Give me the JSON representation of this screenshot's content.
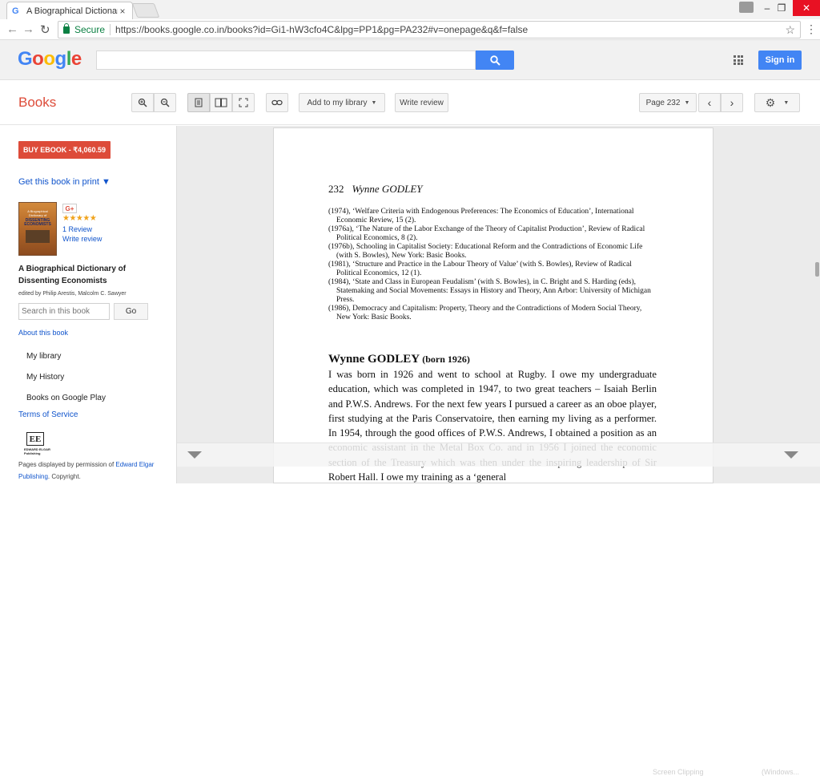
{
  "browser": {
    "tab_title": "A Biographical Dictionary",
    "tab_close": "×",
    "secure_label": "Secure",
    "url": "https://books.google.co.in/books?id=Gi1-hW3cfo4C&lpg=PP1&pg=PA232#v=onepage&q&f=false",
    "window_controls": {
      "minimize": "–",
      "restore": "❐",
      "close": "✕"
    }
  },
  "google_header": {
    "logo": [
      "G",
      "o",
      "o",
      "g",
      "l",
      "e"
    ],
    "search_value": "",
    "signin_label": "Sign in"
  },
  "books_toolbar": {
    "title": "Books",
    "add_library_label": "Add to my library",
    "write_review_label": "Write review",
    "page_label": "Page 232"
  },
  "sidebar": {
    "buy_label": "BUY EBOOK - ₹4,060.59",
    "print_label": "Get this book in print ▼",
    "cover_top": "A Biographical Dictionary of",
    "cover_main": "DISSENTING ECONOMISTS",
    "gplus": "G+",
    "stars": "★★★★★",
    "review_count": "1 Review",
    "write_review": "Write review",
    "book_title": "A Biographical Dictionary of Dissenting Economists",
    "editors": "edited by Philip Arestis, Malcolm C. Sawyer",
    "search_placeholder": "Search in this book",
    "go_label": "Go",
    "about_label": "About this book",
    "items": [
      "My library",
      "My History",
      "Books on Google Play"
    ],
    "tos_label": "Terms of Service",
    "publisher_logo": "EE",
    "publisher_name": "EDWARD ELGAR Publishing",
    "permission_prefix": "Pages displayed by permission of ",
    "permission_link": "Edward Elgar Publishing",
    "permission_suffix": ". Copyright."
  },
  "page": {
    "header_num": "232",
    "header_name": "Wynne GODLEY",
    "refs": [
      "(1974), ‘Welfare Criteria with Endogenous Preferences: The Economics of Education’, International Economic Review, 15 (2).",
      "(1976a), ‘The Nature of the Labor Exchange of the Theory of Capitalist Production’, Review of Radical Political Economics, 8 (2).",
      "(1976b), Schooling in Capitalist Society: Educational Reform and the Contradictions of Economic Life (with S. Bowles), New York: Basic Books.",
      "(1981), ‘Structure and Practice in the Labour Theory of Value’ (with S. Bowles), Review of Radical Political Economics, 12 (1).",
      "(1984), ‘State and Class in European Feudalism’ (with S. Bowles), in C. Bright and S. Harding (eds), Statemaking and Social Movements: Essays in History and Theory, Ann Arbor: University of Michigan Press.",
      "(1986), Democracy and Capitalism: Property, Theory and the Contradictions of Modern Social Theory, New York: Basic Books."
    ],
    "entry_name": "Wynne GODLEY",
    "entry_born": "(born 1926)",
    "entry_body": "I was born in 1926 and went to school at Rugby. I owe my undergraduate education, which was completed in 1947, to two great teachers – Isaiah Berlin and P.W.S. Andrews. For the next few years I pursued a career as an oboe player, first studying at the Paris Conservatoire, then earning my living as a performer. In 1954, through the good offices of P.W.S. Andrews, I obtained a position as an economic assistant in the Metal Box Co. and in 1956 I joined the economic section of the Treasury which was then under the inspiring leadership of Sir Robert Hall. I owe my training as a ‘general"
  },
  "overlay": {
    "ghost1": "Screen Clipping",
    "ghost2": "(Windows..."
  }
}
